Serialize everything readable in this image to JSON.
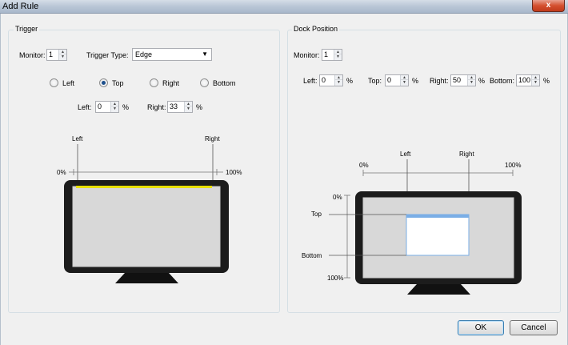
{
  "window": {
    "title": "Add Rule",
    "close_glyph": "x"
  },
  "trigger": {
    "group_title": "Trigger",
    "monitor_label": "Monitor:",
    "monitor_value": "1",
    "type_label": "Trigger Type:",
    "type_value": "Edge",
    "edges": [
      {
        "label": "Left",
        "selected": false
      },
      {
        "label": "Top",
        "selected": true
      },
      {
        "label": "Right",
        "selected": false
      },
      {
        "label": "Bottom",
        "selected": false
      }
    ],
    "left_label": "Left:",
    "left_value": "0",
    "right_label": "Right:",
    "right_value": "33",
    "percent": "%",
    "diagram": {
      "left_label": "Left",
      "right_label": "Right",
      "start_label": "0%",
      "end_label": "100%",
      "highlight_color": "#e8e000",
      "left_pct": 0,
      "right_pct": 100
    }
  },
  "dock": {
    "group_title": "Dock Position",
    "monitor_label": "Monitor:",
    "monitor_value": "1",
    "left_label": "Left:",
    "left_value": "0",
    "top_label": "Top:",
    "top_value": "0",
    "right_label": "Right:",
    "right_value": "50",
    "bottom_label": "Bottom:",
    "bottom_value": "100",
    "percent": "%",
    "diagram": {
      "left_label": "Left",
      "right_label": "Right",
      "top_label": "Top",
      "bottom_label": "Bottom",
      "x_start": "0%",
      "x_end": "100%",
      "y_start": "0%",
      "y_end": "100%",
      "window_color": "#7aaee6"
    }
  },
  "footer": {
    "ok_label": "OK",
    "cancel_label": "Cancel"
  }
}
